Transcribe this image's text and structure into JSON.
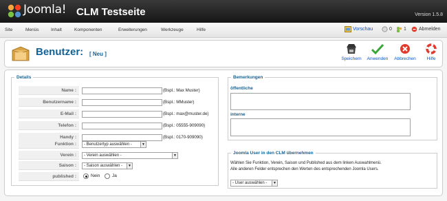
{
  "header": {
    "logo_text": "Joomla!",
    "site_title": "CLM Testseite",
    "version": "Version 1.5.8"
  },
  "menu": {
    "items": [
      "Site",
      "Menüs",
      "Inhalt",
      "Komponenten",
      "Erweiterungen",
      "Werkzeuge",
      "Hilfe"
    ],
    "preview": "Vorschau",
    "messages_count": "0",
    "users_count": "1",
    "logout": "Abmelden"
  },
  "toolbar": {
    "title": "Benutzer:",
    "subtitle": "[ Neu ]",
    "buttons": [
      "Speichern",
      "Anwenden",
      "Abbrechen",
      "Hilfe"
    ]
  },
  "details": {
    "legend": "Details",
    "fields": [
      {
        "label": "Name :",
        "hint": "(Bspl.: Max Muster)"
      },
      {
        "label": "Benutzername :",
        "hint": "(Bspl.: MMuster)"
      },
      {
        "label": "E-Mail :",
        "hint": "(Bspl.: max@muster.de)"
      },
      {
        "label": "Telefon :",
        "hint": "(Bspl.: 05555-909090)"
      },
      {
        "label": "Handy :",
        "hint": "(Bspl.: 0170-909090)"
      }
    ],
    "funktion_label": "Funktion :",
    "funktion_value": "- Benutzertyp auswählen -",
    "verein_label": "Verein :",
    "verein_value": "- Verein auswählen -",
    "saison_label": "Saison :",
    "saison_value": "- Saison auswählen -",
    "published_label": "published :",
    "published_no": "Nein",
    "published_yes": "Ja",
    "published_selected": "Nein"
  },
  "remarks": {
    "legend": "Bemerkungen",
    "public_label": "öffentliche",
    "internal_label": "interne"
  },
  "joomla_user": {
    "legend": "Joomla User in den CLM übernehmen",
    "desc_line1": "Wählen Sie Funktion, Verein, Saison und Published aus dem linken Auswahlmenü.",
    "desc_line2": "Alle anderen Felder entsprechen den Werten des entsprechenden Joomla Users.",
    "select_value": "- User auswählen -"
  },
  "colors": {
    "accent": "#146295",
    "link": "#0b55c4",
    "header_bg": "#1f1f1f"
  }
}
